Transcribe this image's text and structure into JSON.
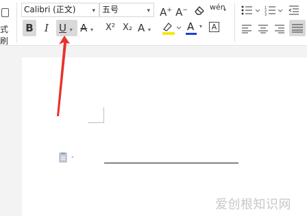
{
  "ribbon": {
    "format_painter_label": "式刷",
    "font_name": "Calibri (正文)",
    "font_size": "五号",
    "buttons": {
      "grow_font": "A",
      "shrink_font": "A",
      "pinyin": "wén",
      "bold": "B",
      "italic": "I",
      "underline": "U",
      "strike": "A",
      "superscript": "X²",
      "subscript": "X₂",
      "text_effect": "A",
      "highlight": "A",
      "font_color": "A",
      "char_border": "A"
    }
  },
  "document": {
    "watermark": "爱创根知识网"
  },
  "colors": {
    "highlight": "#f5e90a",
    "font_color": "#1b3fd6",
    "arrow": "#e8332a"
  }
}
